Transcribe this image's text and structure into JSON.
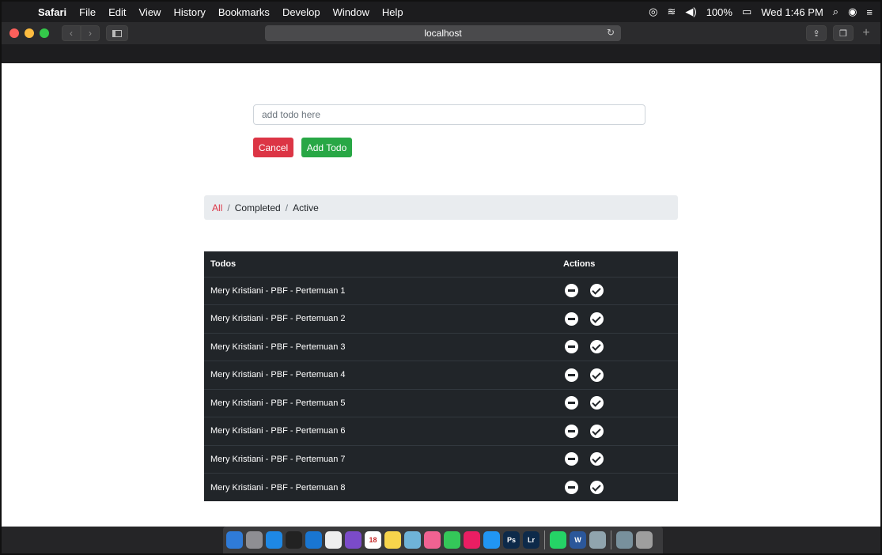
{
  "menubar": {
    "apple_glyph": "",
    "app_name": "Safari",
    "items": [
      "File",
      "Edit",
      "View",
      "History",
      "Bookmarks",
      "Develop",
      "Window",
      "Help"
    ],
    "battery": "100%",
    "clock": "Wed 1:46 PM"
  },
  "toolbar": {
    "url": "localhost",
    "back_glyph": "‹",
    "forward_glyph": "›"
  },
  "form": {
    "input_placeholder": "add todo here",
    "input_value": "",
    "cancel_label": "Cancel",
    "add_label": "Add Todo"
  },
  "filters": {
    "all": "All",
    "completed": "Completed",
    "active": "Active",
    "separator": "/",
    "selected": "All"
  },
  "table": {
    "headers": {
      "todos": "Todos",
      "actions": "Actions"
    },
    "rows": [
      "Mery Kristiani - PBF - Pertemuan 1",
      "Mery Kristiani - PBF - Pertemuan 2",
      "Mery Kristiani - PBF - Pertemuan 3",
      "Mery Kristiani - PBF - Pertemuan 4",
      "Mery Kristiani - PBF - Pertemuan 5",
      "Mery Kristiani - PBF - Pertemuan 6",
      "Mery Kristiani - PBF - Pertemuan 7",
      "Mery Kristiani - PBF - Pertemuan 8"
    ]
  },
  "dock": {
    "apps": [
      {
        "name": "finder-icon",
        "color": "#2f7bd8",
        "glyph": ""
      },
      {
        "name": "launchpad-icon",
        "color": "#8e8e93",
        "glyph": ""
      },
      {
        "name": "safari-icon",
        "color": "#1e88e5",
        "glyph": ""
      },
      {
        "name": "terminal-icon",
        "color": "#222222",
        "glyph": ""
      },
      {
        "name": "vscode-icon",
        "color": "#1976d2",
        "glyph": ""
      },
      {
        "name": "sublime-icon",
        "color": "#eeeeee",
        "glyph": ""
      },
      {
        "name": "github-desktop-icon",
        "color": "#7b4bc9",
        "glyph": ""
      },
      {
        "name": "calendar-icon",
        "color": "#ffffff",
        "glyph": "18"
      },
      {
        "name": "notes-icon",
        "color": "#f7d44c",
        "glyph": ""
      },
      {
        "name": "preview-icon",
        "color": "#6fb3d8",
        "glyph": ""
      },
      {
        "name": "photos-icon",
        "color": "#f06292",
        "glyph": ""
      },
      {
        "name": "messages-icon",
        "color": "#34c759",
        "glyph": ""
      },
      {
        "name": "itunes-icon",
        "color": "#e91e63",
        "glyph": ""
      },
      {
        "name": "app-store-icon",
        "color": "#2196f3",
        "glyph": ""
      },
      {
        "name": "photoshop-icon",
        "color": "#0d2a4a",
        "glyph": "Ps"
      },
      {
        "name": "lightroom-icon",
        "color": "#0d2a4a",
        "glyph": "Lr"
      },
      {
        "name": "whatsapp-icon",
        "color": "#25d366",
        "glyph": ""
      },
      {
        "name": "word-icon",
        "color": "#2b579a",
        "glyph": "W"
      },
      {
        "name": "preview-docs-icon",
        "color": "#90a4ae",
        "glyph": ""
      },
      {
        "name": "downloads-icon",
        "color": "#78909c",
        "glyph": ""
      },
      {
        "name": "trash-icon",
        "color": "#9e9e9e",
        "glyph": ""
      }
    ]
  }
}
